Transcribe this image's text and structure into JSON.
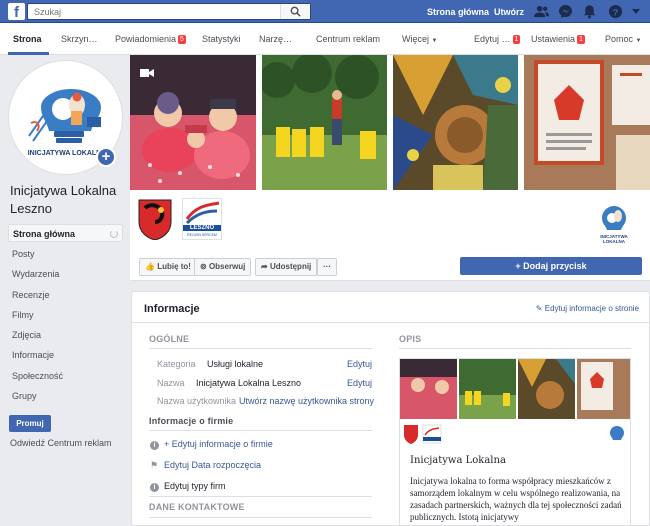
{
  "topbar": {
    "logo": "f",
    "search_placeholder": "Szukaj",
    "home_link": "Strona główna",
    "create_link": "Utwórz",
    "icons": [
      "friends-icon",
      "messenger-icon",
      "notifications-icon",
      "help-icon",
      "caret-down-icon"
    ]
  },
  "nav": {
    "tabs": [
      {
        "label": "Strona"
      },
      {
        "label": "Skrzyn…"
      },
      {
        "label": "Powiadomienia",
        "badge": "5"
      },
      {
        "label": "Statystyki"
      },
      {
        "label": "Narzę…"
      },
      {
        "label": "Centrum reklam"
      },
      {
        "label": "Więcej"
      },
      {
        "label": "Edytuj …",
        "badge": "1"
      },
      {
        "label": "Ustawienia",
        "badge": "1"
      },
      {
        "label": "Pomoc"
      }
    ]
  },
  "left": {
    "logo_text": "INICJATYWA LOKALNA",
    "page_name": "Inicjatywa Lokalna Leszno",
    "menu": [
      "Strona główna",
      "Posty",
      "Wydarzenia",
      "Recenzje",
      "Filmy",
      "Zdjęcia",
      "Informacje",
      "Społeczność",
      "Grupy"
    ],
    "promote": "Promuj",
    "ad_center": "Odwiedź Centrum reklam"
  },
  "cover": {
    "logo_leszno": "LESZNO",
    "logo_leszno_sub": "REGION SERCEM",
    "brand_small": "INICJATYWA LOKALNA"
  },
  "actions": {
    "like": "Lubię to!",
    "follow": "Obserwuj",
    "share": "Udostępnij",
    "more": "···",
    "send": "Dodaj przycisk"
  },
  "info": {
    "title": "Informacje",
    "edit": "Edytuj informacje o stronie",
    "general_head": "OGÓLNE",
    "fields": [
      {
        "label": "Kategoria",
        "value": "Usługi lokalne",
        "action": "Edytuj"
      },
      {
        "label": "Nazwa",
        "value": "Inicjatywa Lokalna Leszno",
        "action": "Edytuj"
      },
      {
        "label": "Nazwa użytkownika",
        "value": "",
        "action": "Utwórz nazwę użytkownika strony"
      }
    ],
    "company_head": "Informacje o firmie",
    "company_rows": [
      "+ Edytuj informacje o firmie",
      "Edytuj Data rozpoczęcia",
      "Edytuj typy firm"
    ],
    "contact_head": "DANE KONTAKTOWE",
    "desc_head": "OPIS",
    "desc_title": "Inicjatywa Lokalna",
    "desc_text": "Inicjatywa lokalna to forma współpracy mieszkańców z samorządem lokalnym w celu wspólnego realizowania, na zasadach partnerskich, ważnych dla tej społeczności zadań publicznych. Istotą inicjatywy"
  }
}
